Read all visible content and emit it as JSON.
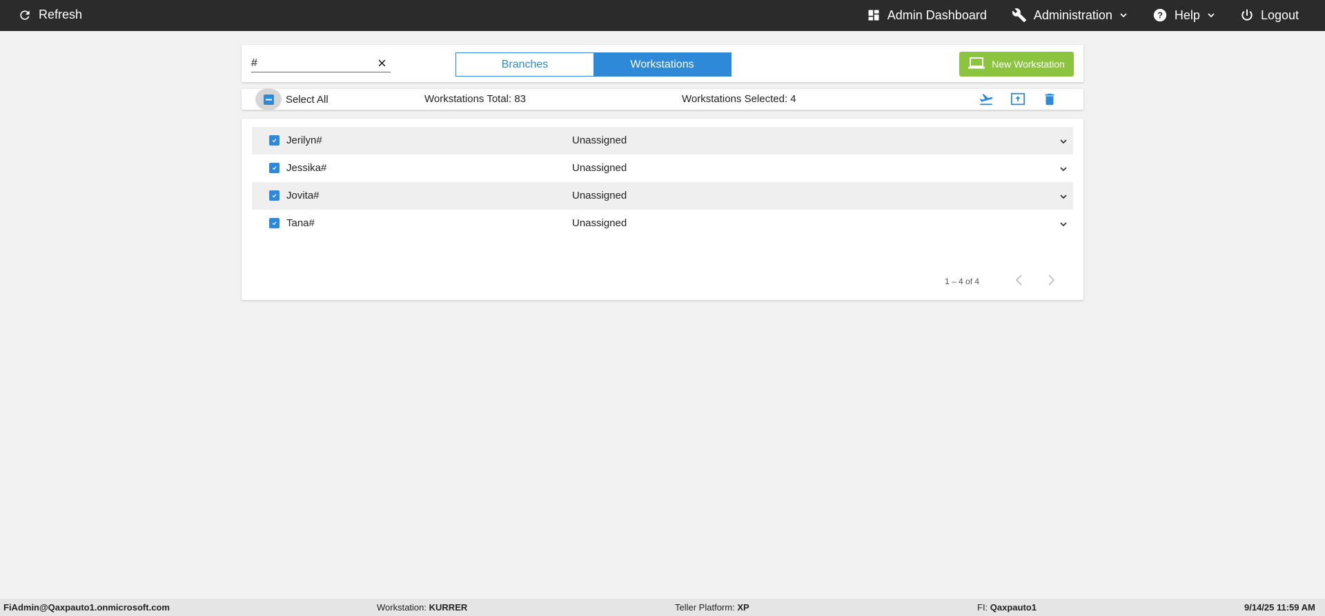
{
  "topbar": {
    "refresh_label": "Refresh",
    "admin_dashboard_label": "Admin Dashboard",
    "administration_label": "Administration",
    "help_label": "Help",
    "logout_label": "Logout"
  },
  "search": {
    "value": "#",
    "placeholder": ""
  },
  "tabs": {
    "branches_label": "Branches",
    "workstations_label": "Workstations",
    "active": "Workstations"
  },
  "new_workstation_label": "New Workstation",
  "summary": {
    "select_all_label": "Select All",
    "total_text": "Workstations Total: 83",
    "selected_text": "Workstations Selected: 4"
  },
  "rows": [
    {
      "name": "Jerilyn#",
      "status": "Unassigned"
    },
    {
      "name": "Jessika#",
      "status": "Unassigned"
    },
    {
      "name": "Jovita#",
      "status": "Unassigned"
    },
    {
      "name": "Tana#",
      "status": "Unassigned"
    }
  ],
  "pager": {
    "range_text": "1 – 4 of 4"
  },
  "footer": {
    "user": "FiAdmin@Qaxpauto1.onmicrosoft.com",
    "workstation_label": "Workstation:",
    "workstation_value": "KURRER",
    "platform_label": "Teller Platform:",
    "platform_value": "XP",
    "fi_label": "FI:",
    "fi_value": "Qaxpauto1",
    "datetime": "9/14/25 11:59 AM"
  },
  "colors": {
    "topbar": "#2b2b2b",
    "accent_blue": "#2e89d9",
    "new_button_green": "#8cc33f",
    "background": "#f2f2f2"
  },
  "icons": {
    "refresh": "refresh-icon",
    "admin_dashboard": "dashboard-icon",
    "administration": "wrench-icon",
    "help": "help-circle-icon",
    "logout": "power-icon",
    "clear": "close-icon",
    "new_workstation": "laptop-icon",
    "actions": [
      "airplane-takeoff-icon",
      "upload-icon",
      "trash-icon"
    ]
  }
}
